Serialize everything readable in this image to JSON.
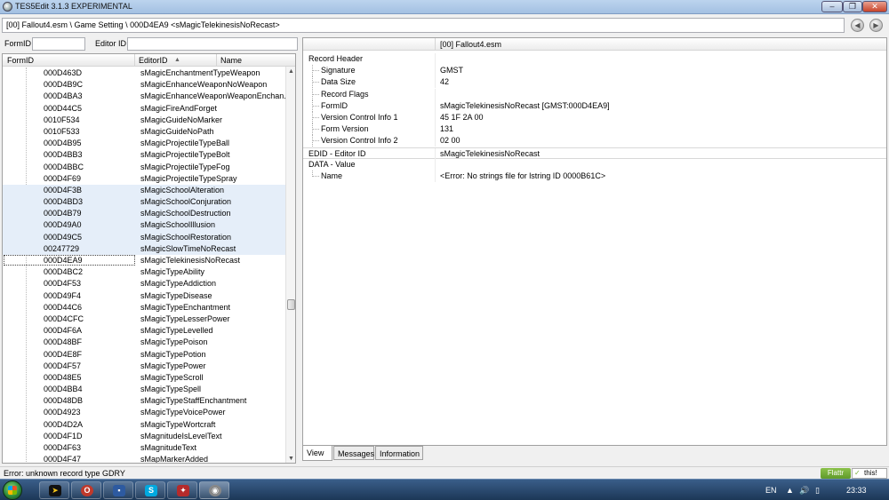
{
  "window": {
    "title": "TES5Edit 3.1.3 EXPERIMENTAL",
    "min_glyph": "–",
    "max_glyph": "❐",
    "close_glyph": "✕"
  },
  "pathbar": {
    "path": "[00] Fallout4.esm \\ Game Setting \\ 000D4EA9 <sMagicTelekinesisNoRecast>"
  },
  "filters": {
    "formid_label": "FormID",
    "editorid_label": "Editor ID"
  },
  "tree": {
    "columns": [
      "FormID",
      "EditorID",
      "Name"
    ],
    "rows": [
      {
        "formid": "000D463D",
        "editorid": "sMagicEnchantmentTypeWeapon"
      },
      {
        "formid": "000D4B9C",
        "editorid": "sMagicEnhanceWeaponNoWeapon"
      },
      {
        "formid": "000D4BA3",
        "editorid": "sMagicEnhanceWeaponWeaponEnchan..."
      },
      {
        "formid": "000D44C5",
        "editorid": "sMagicFireAndForget"
      },
      {
        "formid": "0010F534",
        "editorid": "sMagicGuideNoMarker"
      },
      {
        "formid": "0010F533",
        "editorid": "sMagicGuideNoPath"
      },
      {
        "formid": "000D4B95",
        "editorid": "sMagicProjectileTypeBall"
      },
      {
        "formid": "000D4BB3",
        "editorid": "sMagicProjectileTypeBolt"
      },
      {
        "formid": "000D4BBC",
        "editorid": "sMagicProjectileTypeFog"
      },
      {
        "formid": "000D4F69",
        "editorid": "sMagicProjectileTypeSpray"
      },
      {
        "formid": "000D4F3B",
        "editorid": "sMagicSchoolAlteration"
      },
      {
        "formid": "000D4BD3",
        "editorid": "sMagicSchoolConjuration"
      },
      {
        "formid": "000D4B79",
        "editorid": "sMagicSchoolDestruction"
      },
      {
        "formid": "000D49A0",
        "editorid": "sMagicSchoolIllusion"
      },
      {
        "formid": "000D49C5",
        "editorid": "sMagicSchoolRestoration"
      },
      {
        "formid": "00247729",
        "editorid": "sMagicSlowTimeNoRecast"
      },
      {
        "formid": "000D4EA9",
        "editorid": "sMagicTelekinesisNoRecast"
      },
      {
        "formid": "000D4BC2",
        "editorid": "sMagicTypeAbility"
      },
      {
        "formid": "000D4F53",
        "editorid": "sMagicTypeAddiction"
      },
      {
        "formid": "000D49F4",
        "editorid": "sMagicTypeDisease"
      },
      {
        "formid": "000D44C6",
        "editorid": "sMagicTypeEnchantment"
      },
      {
        "formid": "000D4CFC",
        "editorid": "sMagicTypeLesserPower"
      },
      {
        "formid": "000D4F6A",
        "editorid": "sMagicTypeLevelled"
      },
      {
        "formid": "000D48BF",
        "editorid": "sMagicTypePoison"
      },
      {
        "formid": "000D4E8F",
        "editorid": "sMagicTypePotion"
      },
      {
        "formid": "000D4F57",
        "editorid": "sMagicTypePower"
      },
      {
        "formid": "000D48E5",
        "editorid": "sMagicTypeScroll"
      },
      {
        "formid": "000D4BB4",
        "editorid": "sMagicTypeSpell"
      },
      {
        "formid": "000D48DB",
        "editorid": "sMagicTypeStaffEnchantment"
      },
      {
        "formid": "000D4923",
        "editorid": "sMagicTypeVoicePower"
      },
      {
        "formid": "000D4D2A",
        "editorid": "sMagicTypeWortcraft"
      },
      {
        "formid": "000D4F1D",
        "editorid": "sMagnitudeIsLevelText"
      },
      {
        "formid": "000D4F63",
        "editorid": "sMagnitudeText"
      },
      {
        "formid": "000D4F47",
        "editorid": "sMapMarkerAdded"
      }
    ]
  },
  "view": {
    "file_column": "[00] Fallout4.esm",
    "rows": [
      {
        "label": "Record Header",
        "value": ""
      },
      {
        "label": "Signature",
        "value": "GMST"
      },
      {
        "label": "Data Size",
        "value": "42"
      },
      {
        "label": "Record Flags",
        "value": ""
      },
      {
        "label": "FormID",
        "value": "sMagicTelekinesisNoRecast [GMST:000D4EA9]"
      },
      {
        "label": "Version Control Info 1",
        "value": "45 1F 2A 00"
      },
      {
        "label": "Form Version",
        "value": "131"
      },
      {
        "label": "Version Control Info 2",
        "value": "02 00"
      },
      {
        "label": "EDID - Editor ID",
        "value": "sMagicTelekinesisNoRecast"
      },
      {
        "label": "DATA - Value",
        "value": ""
      },
      {
        "label": "Name",
        "value": "<Error: No strings file for lstring ID 0000B61C>"
      }
    ]
  },
  "tabs": [
    "View",
    "Messages",
    "Information"
  ],
  "status": {
    "message": "Error: unknown record type GDRY",
    "flattr": "Flattr",
    "this": "this!"
  },
  "taskbar": {
    "language": "EN",
    "time": "23:33"
  }
}
